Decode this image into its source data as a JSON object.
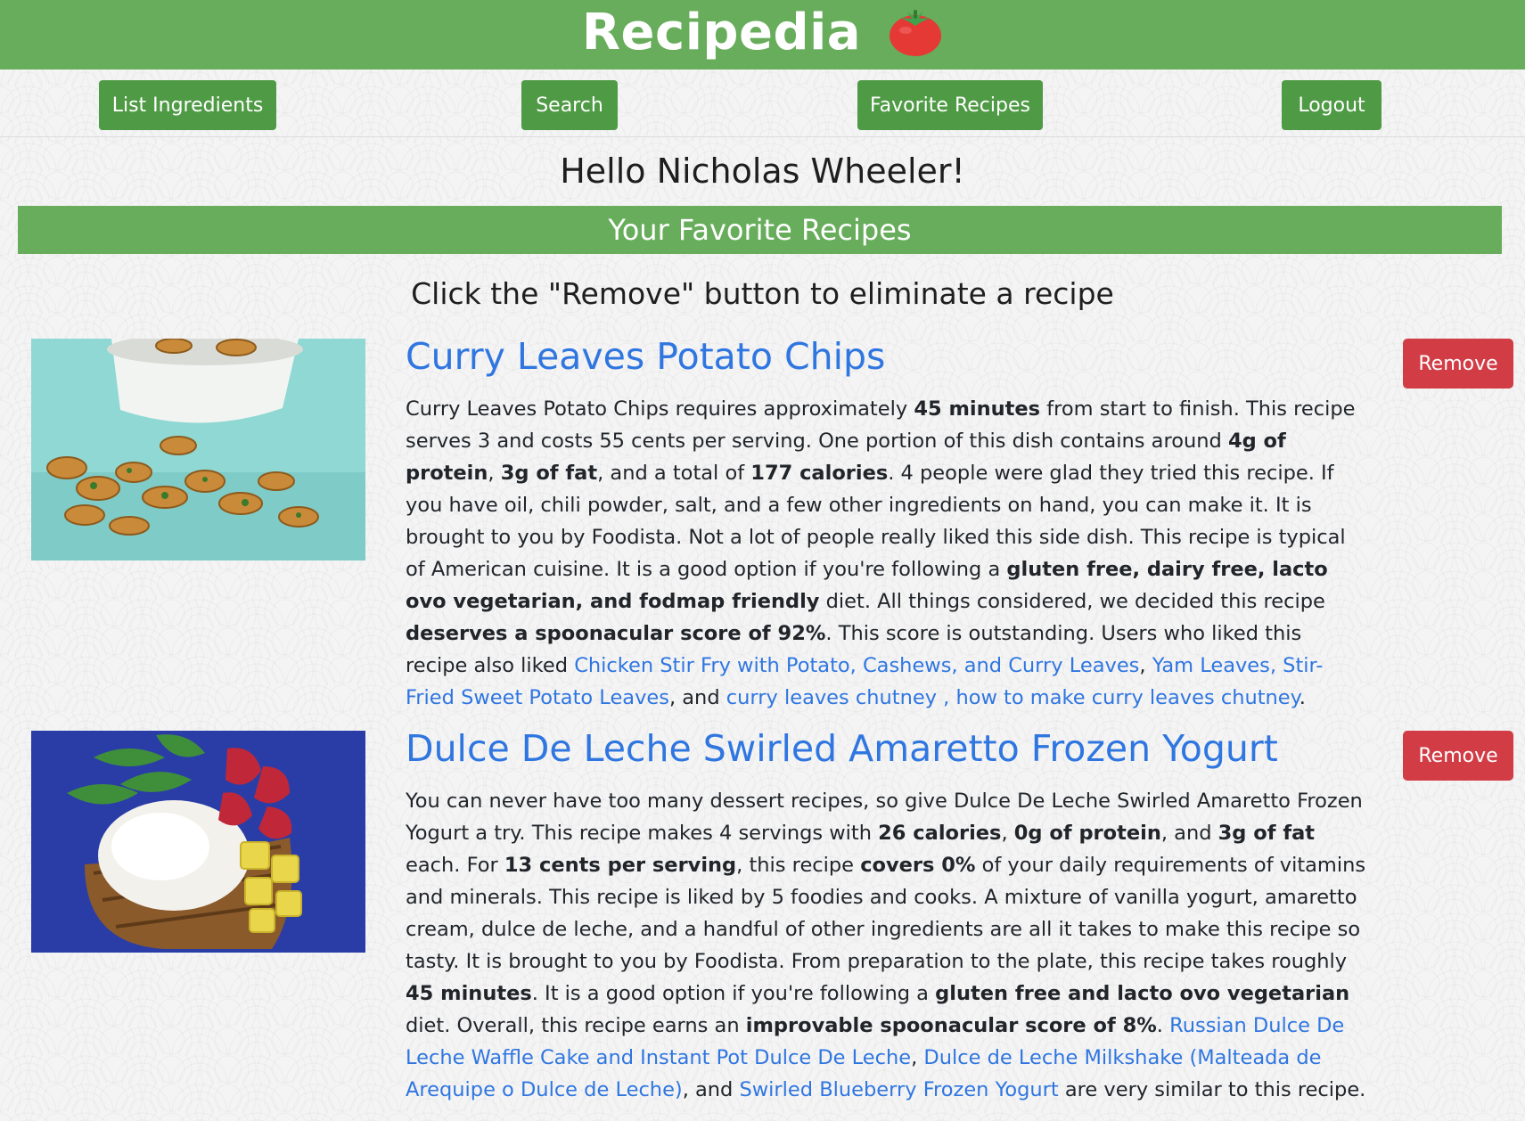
{
  "app": {
    "brand": "Recipedia",
    "brand_color": "#67ad5b",
    "logo_icon": "tomato-icon"
  },
  "nav": {
    "list_ingredients": "List Ingredients",
    "search": "Search",
    "favorite_recipes": "Favorite Recipes",
    "logout": "Logout"
  },
  "greeting": "Hello Nicholas Wheeler!",
  "section_title": "Your Favorite Recipes",
  "instruction": "Click the \"Remove\" button to eliminate a recipe",
  "remove_label": "Remove",
  "recipes": [
    {
      "title": "Curry Leaves Potato Chips",
      "image": "potato-chips-photo",
      "parts": [
        [
          "t",
          "Curry Leaves Potato Chips requires approximately "
        ],
        [
          "b",
          "45 minutes"
        ],
        [
          "t",
          " from start to finish. This recipe serves 3 and costs 55 cents per serving. One portion of this dish contains around "
        ],
        [
          "b",
          "4g of protein"
        ],
        [
          "t",
          ", "
        ],
        [
          "b",
          "3g of fat"
        ],
        [
          "t",
          ", and a total of "
        ],
        [
          "b",
          "177 calories"
        ],
        [
          "t",
          ". 4 people were glad they tried this recipe. If you have oil, chili powder, salt, and a few other ingredients on hand, you can make it. It is brought to you by Foodista. Not a lot of people really liked this side dish. This recipe is typical of American cuisine. It is a good option if you're following a "
        ],
        [
          "b",
          "gluten free, dairy free, lacto ovo vegetarian, and fodmap friendly"
        ],
        [
          "t",
          " diet. All things considered, we decided this recipe "
        ],
        [
          "b",
          "deserves a spoonacular score of 92%"
        ],
        [
          "t",
          ". This score is outstanding. Users who liked this recipe also liked "
        ],
        [
          "a",
          "Chicken Stir Fry with Potato, Cashews, and Curry Leaves"
        ],
        [
          "t",
          ", "
        ],
        [
          "a",
          "Yam Leaves, Stir-Fried Sweet Potato Leaves"
        ],
        [
          "t",
          ", and "
        ],
        [
          "a",
          "curry leaves chutney , how to make curry leaves chutney"
        ],
        [
          "t",
          "."
        ]
      ]
    },
    {
      "title": "Dulce De Leche Swirled Amaretto Frozen Yogurt",
      "image": "frozen-yogurt-photo",
      "parts": [
        [
          "t",
          "You can never have too many dessert recipes, so give Dulce De Leche Swirled Amaretto Frozen Yogurt a try. This recipe makes 4 servings with "
        ],
        [
          "b",
          "26 calories"
        ],
        [
          "t",
          ", "
        ],
        [
          "b",
          "0g of protein"
        ],
        [
          "t",
          ", and "
        ],
        [
          "b",
          "3g of fat"
        ],
        [
          "t",
          " each. For "
        ],
        [
          "b",
          "13 cents per serving"
        ],
        [
          "t",
          ", this recipe "
        ],
        [
          "b",
          "covers 0%"
        ],
        [
          "t",
          " of your daily requirements of vitamins and minerals. This recipe is liked by 5 foodies and cooks. A mixture of vanilla yogurt, amaretto cream, dulce de leche, and a handful of other ingredients are all it takes to make this recipe so tasty. It is brought to you by Foodista. From preparation to the plate, this recipe takes roughly "
        ],
        [
          "b",
          "45 minutes"
        ],
        [
          "t",
          ". It is a good option if you're following a "
        ],
        [
          "b",
          "gluten free and lacto ovo vegetarian"
        ],
        [
          "t",
          " diet. Overall, this recipe earns an "
        ],
        [
          "b",
          "improvable spoonacular score of 8%"
        ],
        [
          "t",
          ". "
        ],
        [
          "a",
          "Russian Dulce De Leche Waffle Cake and Instant Pot Dulce De Leche"
        ],
        [
          "t",
          ", "
        ],
        [
          "a",
          "Dulce de Leche Milkshake (Malteada de Arequipe o Dulce de Leche)"
        ],
        [
          "t",
          ", and "
        ],
        [
          "a",
          "Swirled Blueberry Frozen Yogurt"
        ],
        [
          "t",
          " are very similar to this recipe."
        ]
      ]
    }
  ]
}
